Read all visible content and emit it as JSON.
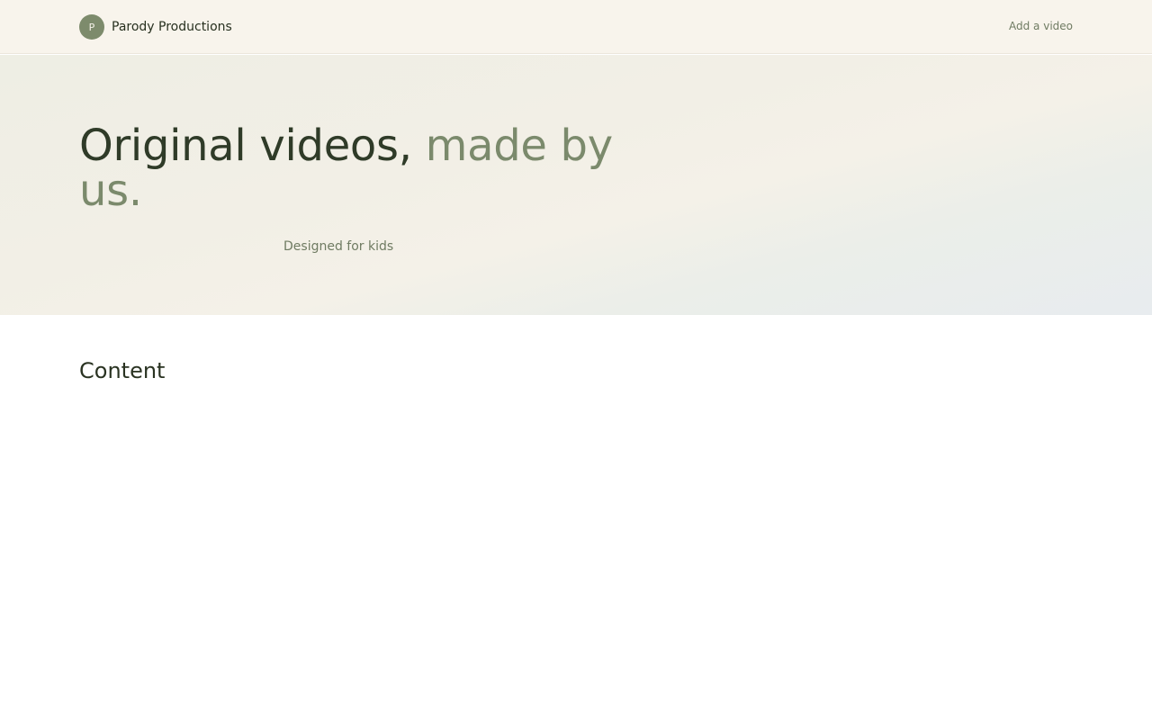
{
  "header": {
    "brand_initial": "P",
    "brand_name": "Parody Productions",
    "nav_add_video": "Add a video"
  },
  "hero": {
    "title_main": "Original videos, ",
    "title_accent": "made by us.",
    "tagline": "Designed for kids"
  },
  "content": {
    "section_title": "Content"
  },
  "colors": {
    "accent": "#7b8a6c",
    "text_dark": "#2f3b28",
    "header_bg": "#f8f4ec"
  }
}
